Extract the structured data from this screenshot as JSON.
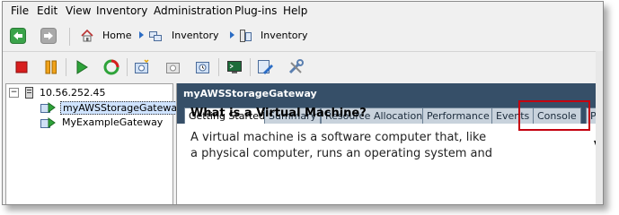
{
  "menu": [
    "File",
    "Edit",
    "View",
    "Inventory",
    "Administration",
    "Plug-ins",
    "Help"
  ],
  "nav": {
    "crumbs": [
      "Home",
      "Inventory",
      "Inventory"
    ]
  },
  "tree": {
    "host": "10.56.252.45",
    "expander": "−",
    "items": [
      {
        "label": "myAWSStorageGateway",
        "selected": true
      },
      {
        "label": "MyExampleGateway",
        "selected": false
      }
    ]
  },
  "content": {
    "title": "myAWSStorageGateway",
    "tabs": [
      "Getting Started",
      "Summary",
      "Resource Allocation",
      "Performance",
      "Events",
      "Console",
      "Per"
    ],
    "heading": "What is a Virtual Machine?",
    "paragraph": "A virtual machine is a software computer that, like a physical computer, runs an operating system and",
    "edge_letter": "Vi"
  },
  "colors": {
    "title_bar": "#364f68",
    "highlight": "#c4000f"
  }
}
